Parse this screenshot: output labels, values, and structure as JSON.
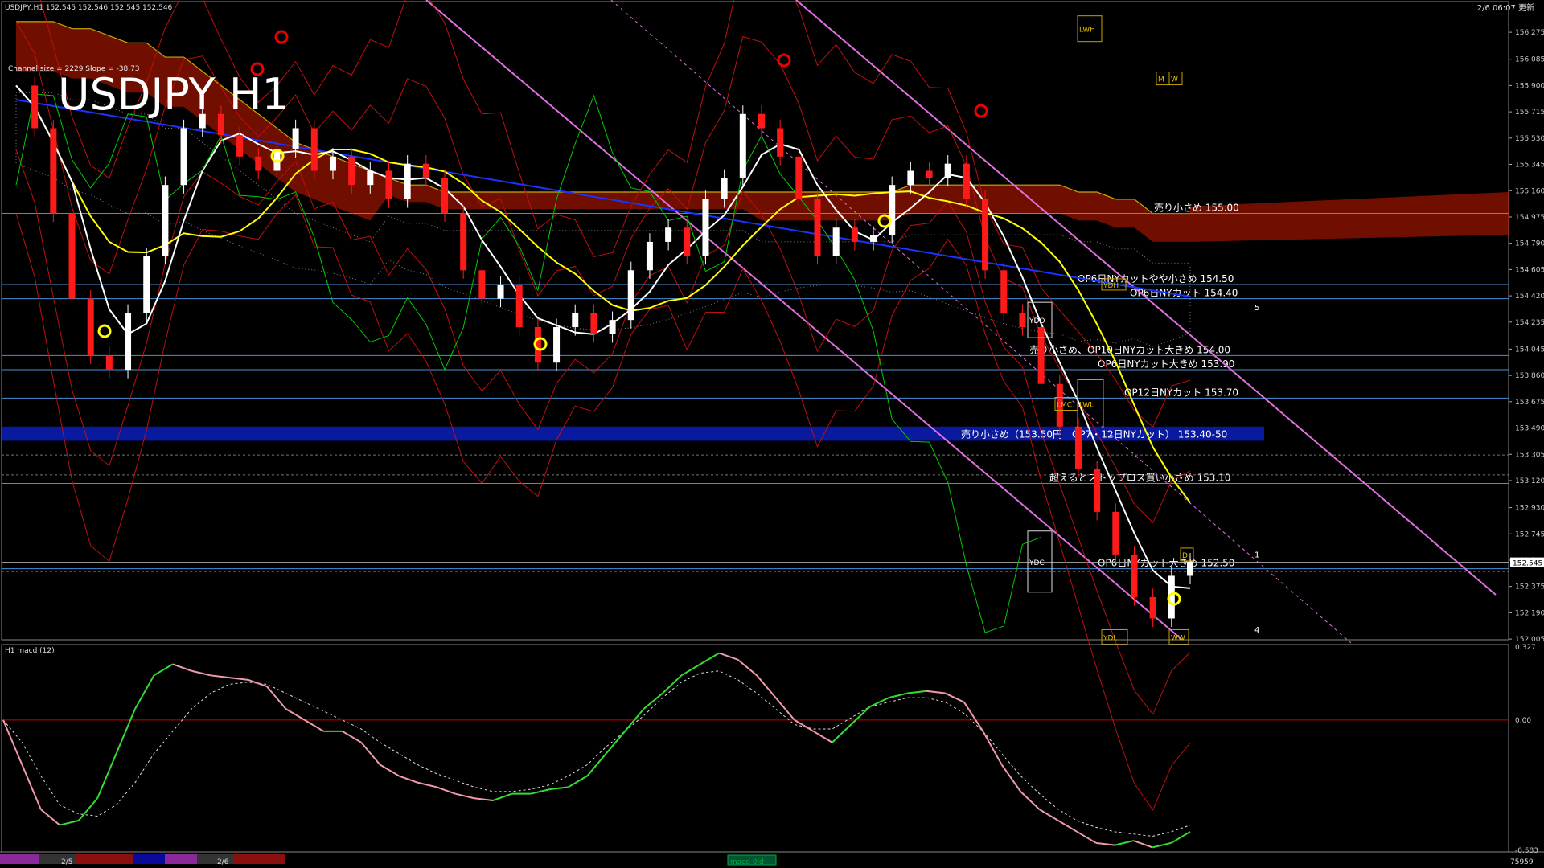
{
  "window": {
    "symbol_header": "USDJPY,H1  152.545 152.546 152.545 152.546",
    "timestamp": "2/6 06:07 更新",
    "watermark_title": "USDJPY H1",
    "channel_info": "Channel size = 2229 Slope = -38.73"
  },
  "subwindow": {
    "label": "H1  macd (12)",
    "bottom_label": "macd 0ld"
  },
  "time_axis": {
    "labels": [
      "2/5",
      "2/6"
    ],
    "right_value": "75959"
  },
  "colors": {
    "bull_candle": "#ffffff",
    "bear_candle": "#ff1a1a",
    "ichimoku_cloud": "#cc1a00",
    "cloud_dots": "#d8d8d8",
    "ma_fast": "#ffffff",
    "ma_mid": "#ffff00",
    "ma_slow": "#1a33ff",
    "chikou": "#00cc00",
    "channel": "#e070e0",
    "bollinger": "#c01010",
    "level_line": "#4a8fd6",
    "band": "#0a1a9e",
    "macd_up": "#33dd33",
    "macd_down": "#f09aaa"
  },
  "chart_data": [
    {
      "type": "line",
      "ylim": [
        152.0,
        156.4
      ],
      "y_ticks": [
        "156.275",
        "156.085",
        "155.900",
        "155.715",
        "155.530",
        "155.345",
        "155.160",
        "154.975",
        "154.790",
        "154.605",
        "154.420",
        "154.235",
        "154.045",
        "153.860",
        "153.675",
        "153.490",
        "153.305",
        "153.120",
        "152.930",
        "152.745",
        "152.560",
        "152.375",
        "152.190",
        "152.005"
      ],
      "current_price": "152.545",
      "close_path": [
        155.9,
        155.6,
        155.0,
        154.4,
        154.0,
        153.9,
        154.3,
        154.7,
        155.2,
        155.6,
        155.7,
        155.55,
        155.4,
        155.3,
        155.45,
        155.6,
        155.3,
        155.4,
        155.2,
        155.3,
        155.1,
        155.35,
        155.25,
        155.0,
        154.6,
        154.4,
        154.5,
        154.2,
        153.95,
        154.2,
        154.3,
        154.15,
        154.25,
        154.6,
        154.8,
        154.9,
        154.7,
        155.1,
        155.25,
        155.7,
        155.6,
        155.4,
        155.1,
        154.7,
        154.9,
        154.8,
        154.85,
        155.2,
        155.3,
        155.25,
        155.35,
        155.1,
        154.6,
        154.3,
        154.2,
        153.8,
        153.5,
        153.2,
        152.9,
        152.6,
        152.3,
        152.15,
        152.45,
        152.55
      ],
      "levels": [
        {
          "label": "売り小さめ 155.00",
          "value": 155.0
        },
        {
          "label": "OP6日NYカットやや小さめ 154.50",
          "value": 154.5
        },
        {
          "label": "OP6日NYカット 154.40",
          "value": 154.4
        },
        {
          "label": "売り小さめ、OP10日NYカット大きめ 154.00",
          "value": 154.0
        },
        {
          "label": "OP6日NYカット大きめ 153.90",
          "value": 153.9
        },
        {
          "label": "OP12日NYカット 153.70",
          "value": 153.7
        },
        {
          "label": "超えるとストップロス買い小さめ 153.10",
          "value": 153.1
        },
        {
          "label": "OP6日NYカット大きめ 152.50",
          "value": 152.5
        }
      ],
      "band_label": "売り小さめ（153.50円　OP7・12日NYカット） 153.40-50",
      "band": [
        153.4,
        153.5
      ],
      "box_labels": [
        "YDO",
        "YDC",
        "YDL",
        "LWH",
        "LWL",
        "LMC",
        "M",
        "W",
        "D",
        "WW",
        "YDH"
      ],
      "wave_labels": [
        "1",
        "4",
        "5"
      ]
    },
    {
      "type": "line",
      "ylim": [
        -0.583,
        0.327
      ],
      "y_ticks": [
        "0.327",
        "0.00",
        "-0.583"
      ],
      "macd": [
        0.0,
        -0.2,
        -0.4,
        -0.47,
        -0.45,
        -0.35,
        -0.15,
        0.05,
        0.2,
        0.25,
        0.22,
        0.2,
        0.19,
        0.18,
        0.15,
        0.05,
        0.0,
        -0.05,
        -0.05,
        -0.1,
        -0.2,
        -0.25,
        -0.28,
        -0.3,
        -0.33,
        -0.35,
        -0.36,
        -0.33,
        -0.33,
        -0.31,
        -0.3,
        -0.25,
        -0.15,
        -0.05,
        0.05,
        0.12,
        0.2,
        0.25,
        0.3,
        0.27,
        0.2,
        0.1,
        0.0,
        -0.05,
        -0.1,
        -0.02,
        0.06,
        0.1,
        0.12,
        0.13,
        0.12,
        0.08,
        -0.05,
        -0.2,
        -0.32,
        -0.4,
        -0.45,
        -0.5,
        -0.55,
        -0.56,
        -0.54,
        -0.57,
        -0.55,
        -0.5
      ],
      "signal": [
        0.0,
        -0.1,
        -0.25,
        -0.38,
        -0.42,
        -0.43,
        -0.38,
        -0.28,
        -0.15,
        -0.05,
        0.05,
        0.12,
        0.16,
        0.17,
        0.16,
        0.12,
        0.08,
        0.04,
        0.0,
        -0.04,
        -0.1,
        -0.15,
        -0.2,
        -0.24,
        -0.27,
        -0.3,
        -0.32,
        -0.32,
        -0.31,
        -0.29,
        -0.25,
        -0.2,
        -0.12,
        -0.05,
        0.02,
        0.1,
        0.17,
        0.21,
        0.22,
        0.18,
        0.12,
        0.05,
        -0.02,
        -0.04,
        -0.04,
        0.01,
        0.06,
        0.08,
        0.1,
        0.1,
        0.08,
        0.03,
        -0.05,
        -0.15,
        -0.25,
        -0.33,
        -0.4,
        -0.45,
        -0.48,
        -0.5,
        -0.51,
        -0.52,
        -0.5,
        -0.47
      ]
    }
  ]
}
